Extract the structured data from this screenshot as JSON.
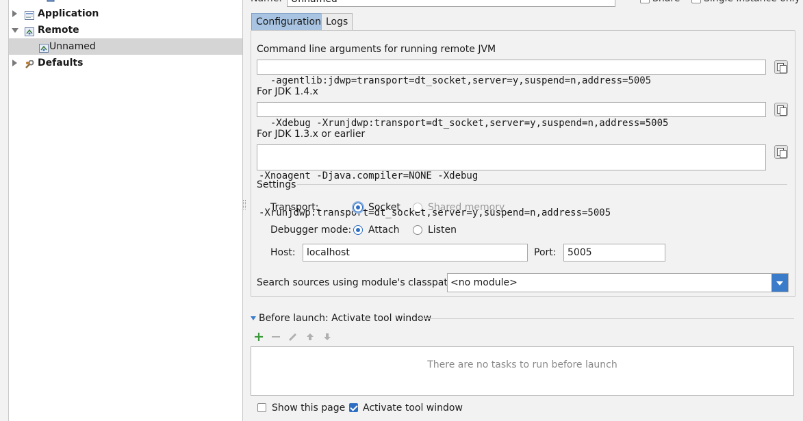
{
  "header": {
    "name_label": "Name:",
    "name_value": "Unnamed",
    "share_label": "Share",
    "single_instance_label": "Single instance only"
  },
  "tree": {
    "items": [
      {
        "label": "Application"
      },
      {
        "label": "Remote"
      },
      {
        "label": "Unnamed"
      },
      {
        "label": "Defaults"
      }
    ]
  },
  "tabs": [
    {
      "label": "Configuration"
    },
    {
      "label": "Logs"
    }
  ],
  "config": {
    "cmd_label": "Command line arguments for running remote JVM",
    "cmd_value": "-agentlib:jdwp=transport=dt_socket,server=y,suspend=n,address=5005",
    "jdk14_label": "For JDK 1.4.x",
    "jdk14_value": "-Xdebug -Xrunjdwp:transport=dt_socket,server=y,suspend=n,address=5005",
    "jdk13_label": "For JDK 1.3.x or earlier",
    "jdk13_line1": "-Xnoagent -Djava.compiler=NONE -Xdebug",
    "jdk13_line2": "-Xrunjdwp:transport=dt_socket,server=y,suspend=n,address=5005"
  },
  "settings": {
    "title": "Settings",
    "transport_label": "Transport:",
    "transport_options": [
      "Socket",
      "Shared memory"
    ],
    "transport_selected": "Socket",
    "debugger_mode_label": "Debugger mode:",
    "debugger_options": [
      "Attach",
      "Listen"
    ],
    "debugger_selected": "Attach",
    "host_label": "Host:",
    "host_value": "localhost",
    "port_label": "Port:",
    "port_value": "5005",
    "module_label": "Search sources using module's classpath:",
    "module_value": "<no module>"
  },
  "before_launch": {
    "title": "Before launch: Activate tool window",
    "empty_text": "There are no tasks to run before launch",
    "show_page_label": "Show this page",
    "show_page_checked": false,
    "activate_label": "Activate tool window",
    "activate_checked": true
  },
  "colors": {
    "accent": "#2d6ec3",
    "tab_active": "#a8c4e2",
    "add_green": "#3a9a3a"
  }
}
